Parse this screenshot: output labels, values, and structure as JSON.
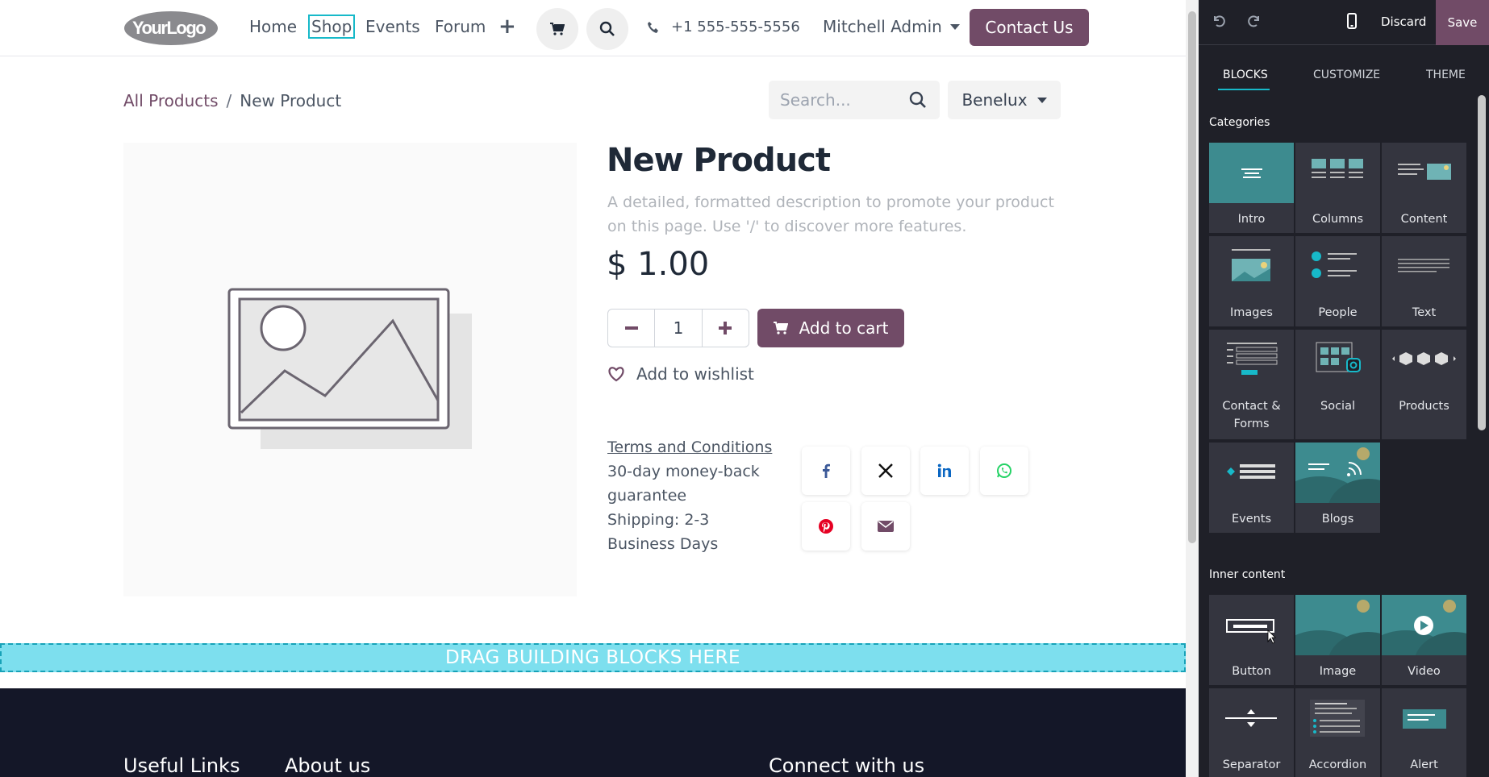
{
  "header": {
    "logo_text": "YourLogo",
    "nav": [
      "Home",
      "Shop",
      "Events",
      "Forum"
    ],
    "phone": "+1 555-555-5556",
    "user": "Mitchell Admin",
    "contact_button": "Contact Us"
  },
  "breadcrumb": {
    "root": "All Products",
    "separator": "/",
    "current": "New Product"
  },
  "search": {
    "placeholder": "Search..."
  },
  "pricelist": {
    "label": "Benelux"
  },
  "product": {
    "name": "New Product",
    "description": "A detailed, formatted description to promote your product on this page. Use '/' to discover more features.",
    "price": "$ 1.00",
    "quantity": "1",
    "add_to_cart": "Add to cart",
    "wishlist": "Add to wishlist",
    "terms_link": "Terms and Conditions",
    "guarantee": "30-day money-back guarantee",
    "shipping": "Shipping: 2-3 Business Days"
  },
  "drop_zone": "DRAG BUILDING BLOCKS HERE",
  "footer": {
    "col1": "Useful Links",
    "col2": "About us",
    "col3": "Connect with us"
  },
  "colors": {
    "brand": "#714b67",
    "accent": "#17b9c9",
    "panel_bg": "#1f2028",
    "footer_bg": "#141728"
  },
  "editor": {
    "discard": "Discard",
    "save": "Save",
    "tabs": [
      "BLOCKS",
      "CUSTOMIZE",
      "THEME"
    ],
    "categories_title": "Categories",
    "categories": [
      "Intro",
      "Columns",
      "Content",
      "Images",
      "People",
      "Text",
      "Contact & Forms",
      "Social",
      "Products",
      "Events",
      "Blogs"
    ],
    "inner_title": "Inner content",
    "inner": [
      "Button",
      "Image",
      "Video",
      "Separator",
      "Accordion",
      "Alert"
    ]
  }
}
